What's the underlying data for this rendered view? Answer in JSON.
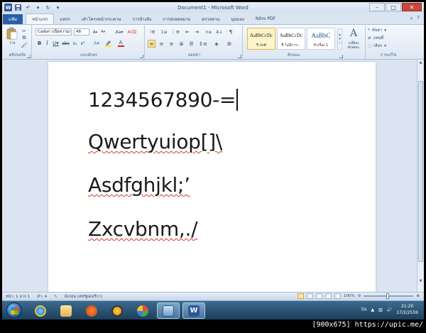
{
  "window": {
    "title": "Document1 - Microsoft Word",
    "app_icon": "W"
  },
  "quick_access": [
    "save-icon",
    "undo-icon",
    "redo-icon",
    "customize-icon"
  ],
  "tabs": [
    {
      "label": "แฟ้ม"
    },
    {
      "label": "หน้าแรก"
    },
    {
      "label": "แทรก"
    },
    {
      "label": "เค้าโครงหน้ากระดาษ"
    },
    {
      "label": "การอ้างอิง"
    },
    {
      "label": "การส่งจดหมาย"
    },
    {
      "label": "ตรวจทาน"
    },
    {
      "label": "มุมมอง"
    },
    {
      "label": "Nitro PDF"
    }
  ],
  "ribbon": {
    "clipboard": {
      "label": "คลิปบอร์ด",
      "paste_label": "วาง"
    },
    "font": {
      "label": "แบบอักษร",
      "font_name": "Calibri (เนื้อความ)",
      "font_size": "48"
    },
    "paragraph": {
      "label": "ย่อหน้า"
    },
    "styles": {
      "label": "ลักษณะ",
      "items": [
        {
          "sample": "AaBbCcDc",
          "name": "¶ ปกติ"
        },
        {
          "sample": "AaBbCcDc",
          "name": "¶ ไม่มีการ..."
        },
        {
          "sample": "AaBbC",
          "name": "หัวเรื่อง 1"
        }
      ],
      "change_label": "เปลี่ยน ลักษณะ"
    },
    "editing": {
      "label": "การแก้ไข",
      "find": "ค้นหา",
      "replace": "แทนที่",
      "select": "เลือก"
    }
  },
  "document": {
    "lines": [
      "1234567890-=",
      "Qwertyuiop[]\\",
      "Asdfghjkl;’",
      "Zxcvbnm,./"
    ]
  },
  "statusbar": {
    "page": "หน้า: 1 จาก 1",
    "words": "คำ: 4",
    "language": "อังกฤษ (สหรัฐอเมริกา)",
    "zoom": "100%"
  },
  "taskbar": {
    "apps": [
      "ie-icon",
      "explorer-icon",
      "media-icon",
      "paint-icon",
      "network-icon",
      "word-icon"
    ],
    "lang": "TH",
    "time": "21:20",
    "date": "17/2/2559"
  },
  "watermark": "[900x675] https://upic.me/"
}
